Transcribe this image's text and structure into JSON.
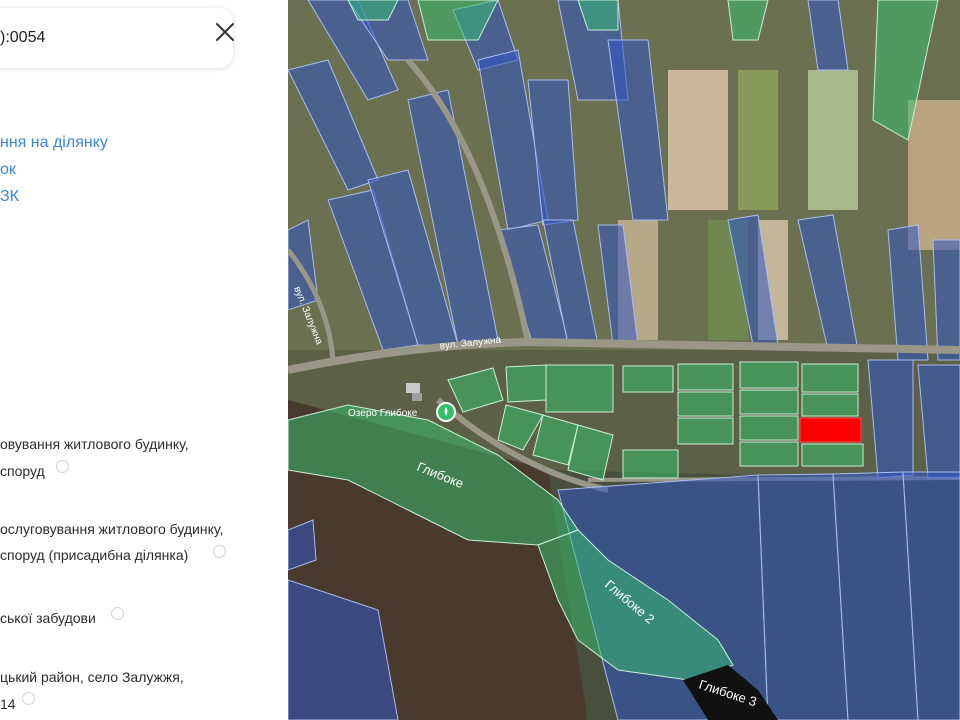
{
  "panel": {
    "cadastral_number_fragment": "):0054",
    "links": [
      "ння на ділянку",
      "ок",
      "ЗК"
    ],
    "purpose_lines": [
      "овування житлового будинку,",
      "споруд"
    ],
    "category_lines": [
      "ослуговування житлового будинку,",
      "споруд (присадибна ділянка)"
    ],
    "zone": "ської забудови",
    "address_lines": [
      "цький район, село Залужжя,",
      "14"
    ]
  },
  "map": {
    "street_label": "вул. Залужна",
    "street_label_2": "вул. Залужна",
    "place_label": "Озеро Глибоке",
    "lake_labels": [
      "Глибоке",
      "Глибоке 2",
      "Глибоке 3"
    ],
    "colors": {
      "cadastre_blue": "#2f55c4",
      "cadastre_green": "#35c470",
      "selected_parcel": "#ff0000",
      "link": "#3a87d6"
    }
  }
}
